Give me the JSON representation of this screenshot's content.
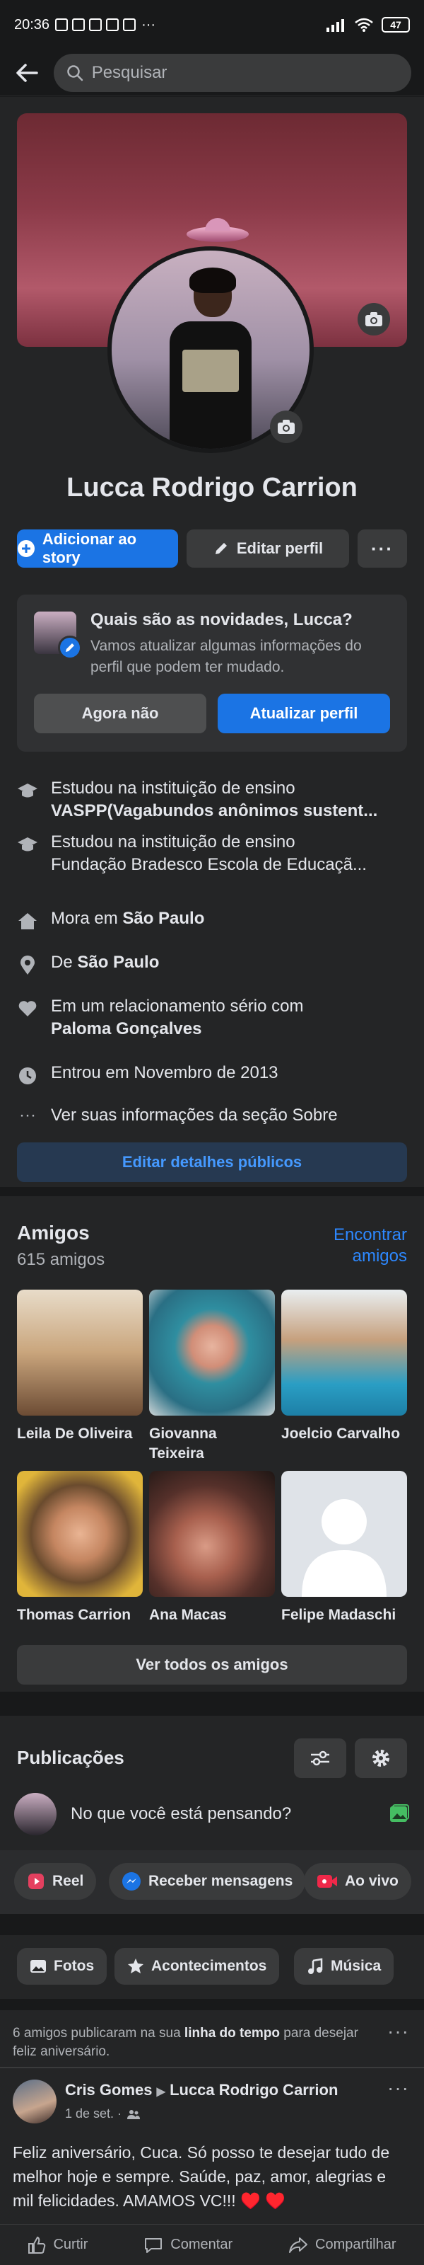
{
  "status_bar": {
    "time": "20:36",
    "battery": "47"
  },
  "search": {
    "placeholder": "Pesquisar"
  },
  "profile": {
    "name": "Lucca Rodrigo Carrion",
    "add_story": "Adicionar ao story",
    "edit_profile": "Editar perfil"
  },
  "news_box": {
    "title": "Quais são as novidades, Lucca?",
    "subtitle": "Vamos atualizar algumas informações do perfil que podem ter mudado.",
    "not_now": "Agora não",
    "update": "Atualizar perfil"
  },
  "info": [
    {
      "prefix": "Estudou na instituição de ensino",
      "bold": "VASPP(Vagabundos anônimos sustent..."
    },
    {
      "prefix": "Estudou na instituição de ensino",
      "second": "Fundação Bradesco Escola de Educaçã..."
    },
    {
      "prefix": "Mora em ",
      "bold": "São Paulo"
    },
    {
      "prefix": "De ",
      "bold": "São Paulo"
    },
    {
      "prefix": "Em um relacionamento sério com",
      "bold": "Paloma Gonçalves"
    },
    {
      "prefix": "Entrou em Novembro de 2013"
    },
    {
      "prefix": "Ver suas informações da seção Sobre"
    }
  ],
  "edit_public": "Editar detalhes públicos",
  "friends": {
    "title": "Amigos",
    "count": "615 amigos",
    "find": "Encontrar amigos",
    "list": [
      {
        "name": "Leila De Oliveira"
      },
      {
        "name": "Giovanna Teixeira"
      },
      {
        "name": "Joelcio Carvalho"
      },
      {
        "name": "Thomas Carrion"
      },
      {
        "name": "Ana Macas"
      },
      {
        "name": "Felipe Madaschi"
      }
    ],
    "see_all": "Ver todos os amigos"
  },
  "publications": {
    "title": "Publicações",
    "composer_placeholder": "No que você está pensando?",
    "chips_row1": [
      "Reel",
      "Receber mensagens",
      "Ao vivo"
    ],
    "chips_row2": [
      "Fotos",
      "Acontecimentos",
      "Música"
    ]
  },
  "birthday_notice": {
    "pre": "6 amigos publicaram na sua ",
    "bold": "linha do tempo",
    "post": " para desejar feliz aniversário."
  },
  "post": {
    "author": "Cris Gomes",
    "target": "Lucca Rodrigo Carrion",
    "date": "1 de set. ·",
    "text": "Feliz aniversário,  Cuca. Só posso te desejar tudo de melhor hoje e sempre.  Saúde,  paz, amor, alegrias e mil felicidades.  AMAMOS VC!!! ♥️ ♥️",
    "like": "Curtir",
    "comment": "Comentar",
    "share": "Compartilhar"
  },
  "colors": {
    "accent": "#1b74e4",
    "background": "#18191a",
    "surface": "#242526"
  }
}
